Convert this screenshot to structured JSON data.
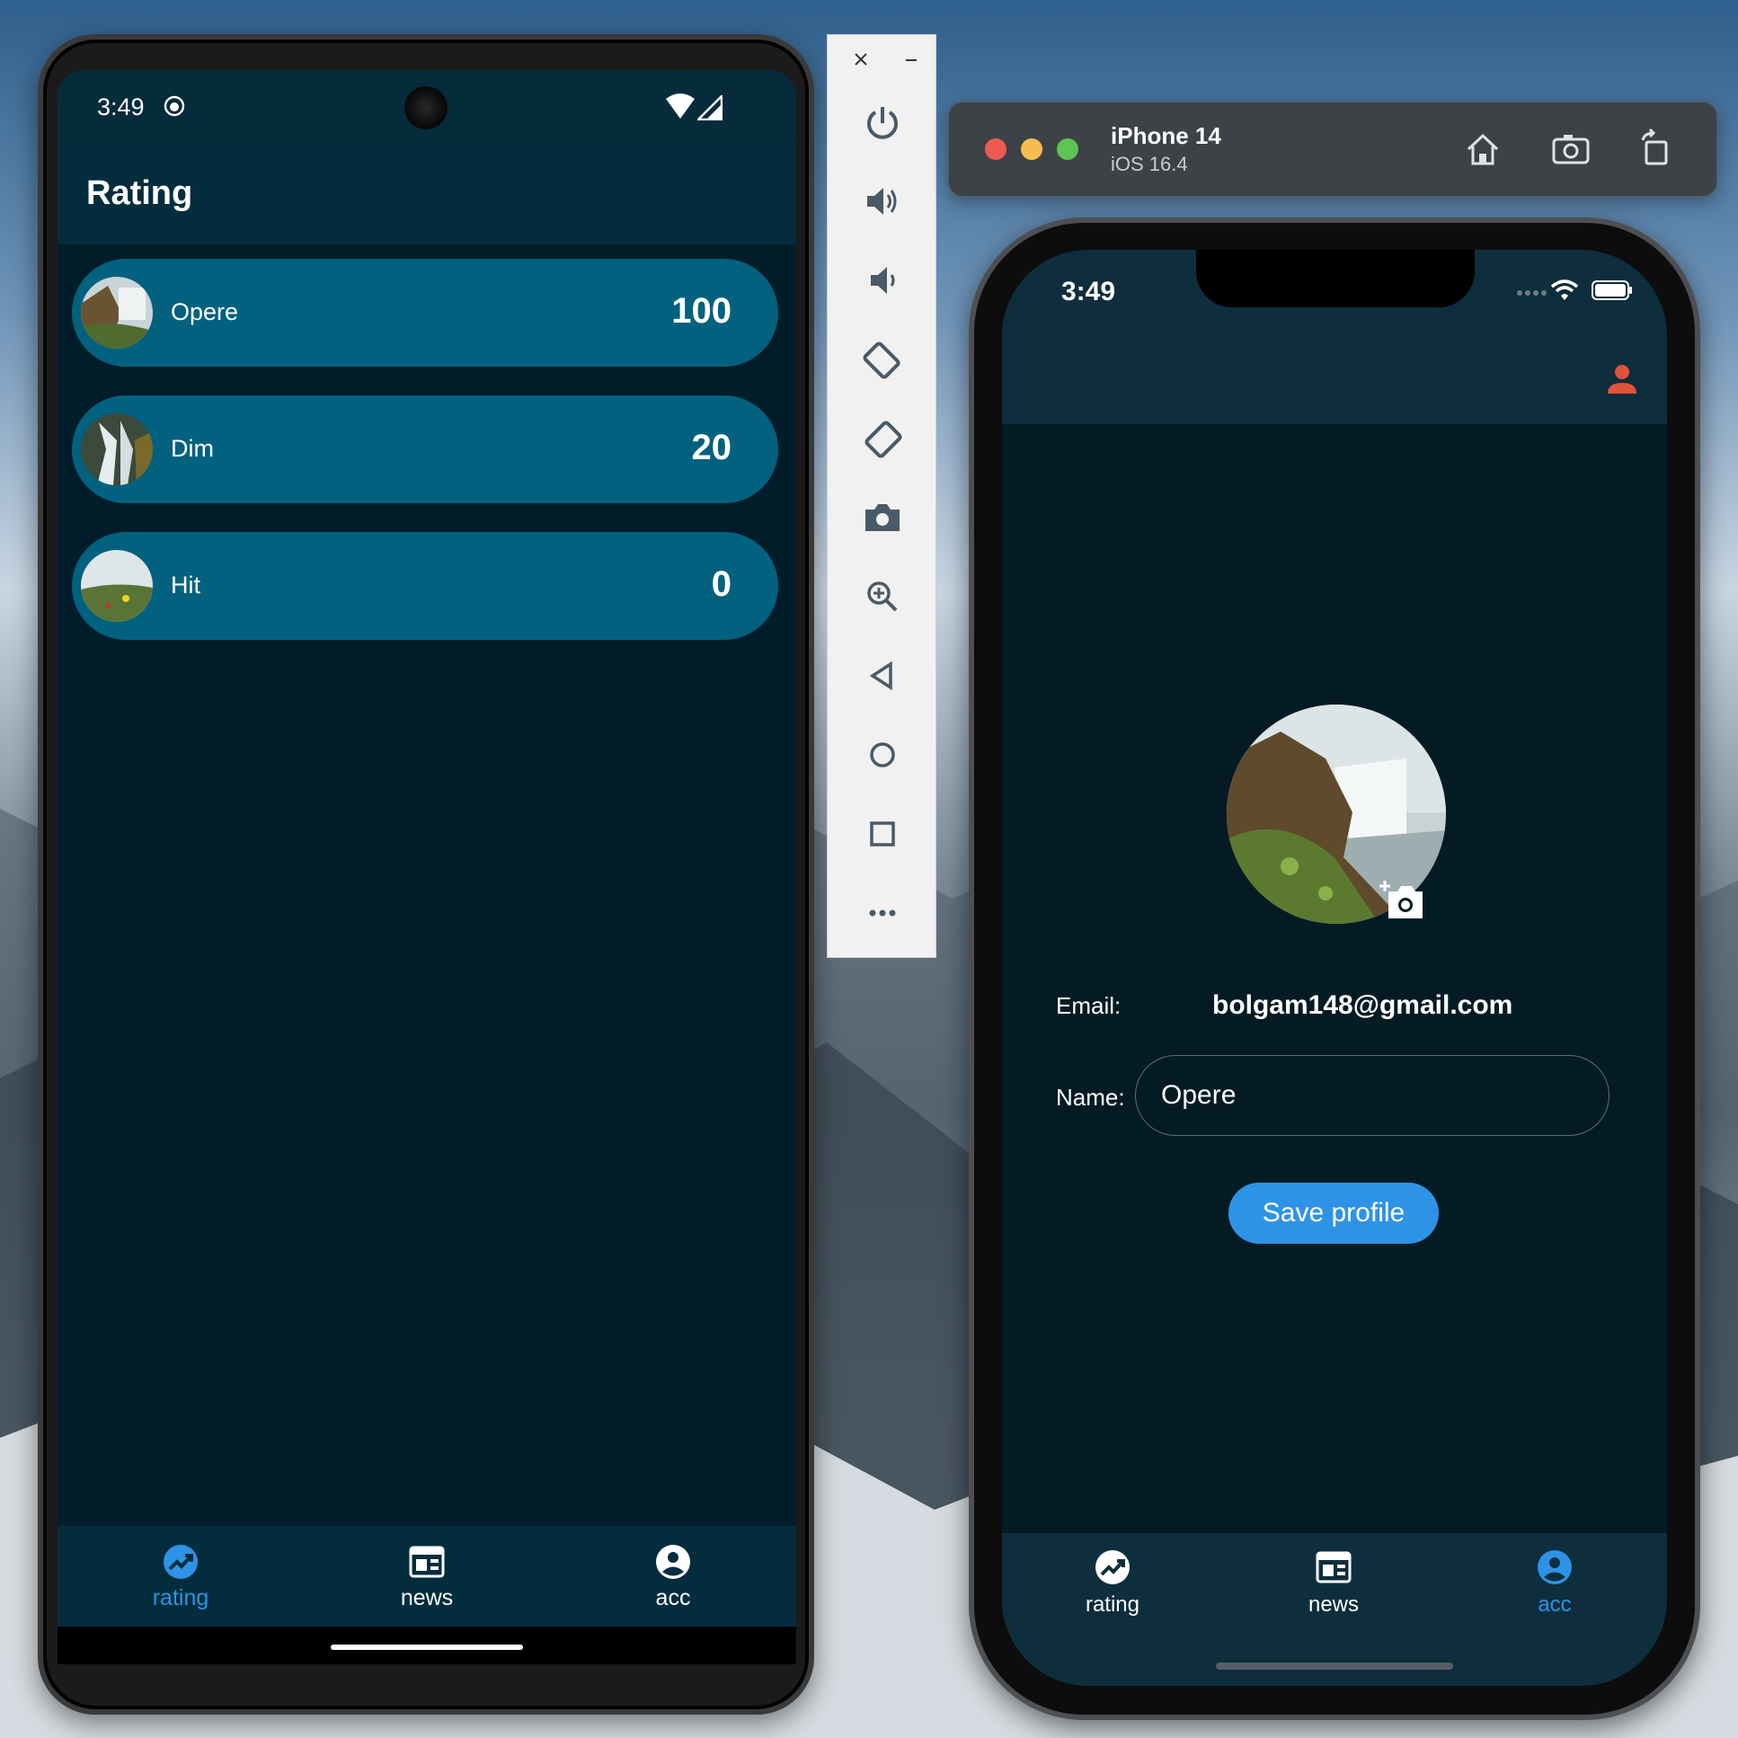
{
  "android": {
    "status_time": "3:49",
    "app_title": "Rating",
    "ratings": [
      {
        "name": "Opere",
        "score": "100"
      },
      {
        "name": "Dim",
        "score": "20"
      },
      {
        "name": "Hit",
        "score": "0"
      }
    ],
    "nav": [
      {
        "label": "rating",
        "icon": "trending-up-icon",
        "active": true
      },
      {
        "label": "news",
        "icon": "newspaper-icon",
        "active": false
      },
      {
        "label": "acc",
        "icon": "account-circle-icon",
        "active": false
      }
    ]
  },
  "emulator_toolbar": {
    "buttons": [
      "close-icon",
      "minimize-icon",
      "power-icon",
      "volume-up-icon",
      "volume-down-icon",
      "rotate-left-icon",
      "rotate-right-icon",
      "camera-icon",
      "zoom-icon",
      "back-icon",
      "home-icon",
      "overview-icon",
      "more-icon"
    ]
  },
  "simulator": {
    "device": "iPhone 14",
    "os": "iOS 16.4",
    "status_time": "3:49",
    "email_label": "Email:",
    "email_value": "bolgam148@gmail.com",
    "name_label": "Name:",
    "name_value": "Opere",
    "save_label": "Save profile",
    "nav": [
      {
        "label": "rating",
        "icon": "trending-up-icon",
        "active": false
      },
      {
        "label": "news",
        "icon": "newspaper-icon",
        "active": false
      },
      {
        "label": "acc",
        "icon": "account-circle-icon",
        "active": true
      }
    ]
  },
  "colors": {
    "accent": "#2e93e6",
    "card": "#02617f",
    "android_bg": "#021d2a",
    "ios_bg": "#051b24",
    "person_icon": "#e0533a"
  }
}
